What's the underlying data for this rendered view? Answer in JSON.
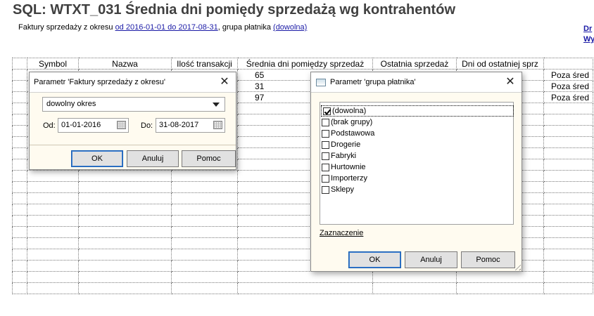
{
  "report": {
    "title": "SQL: WTXT_031 Średnia dni pomiędy sprzedażą wg kontrahentów",
    "subtitle_prefix": "Faktury sprzedaży z okresu ",
    "period_link": "od 2016-01-01 do 2017-08-31",
    "subtitle_mid": ", grupa płatnika ",
    "group_link": "(dowolna)",
    "right_link1": "Dr",
    "right_link2": "Wy",
    "columns": [
      "Symbol",
      "Nazwa",
      "Ilość transakcji",
      "Średnia dni pomiędzy sprzedaż",
      "Ostatnia sprzedaż",
      "Dni od ostatniej sprz",
      ""
    ],
    "rows": [
      [
        "",
        "",
        "",
        "65",
        "",
        "",
        "Poza śred"
      ],
      [
        "",
        "",
        "",
        "31",
        "",
        "",
        "Poza śred"
      ],
      [
        "",
        "",
        "",
        "97",
        "",
        "",
        "Poza śred"
      ]
    ]
  },
  "dialog_period": {
    "title": "Parametr 'Faktury sprzedaży z okresu'",
    "combo_value": "dowolny okres",
    "from_label": "Od:",
    "from_value": "01-01-2016",
    "to_label": "Do:",
    "to_value": "31-08-2017",
    "ok": "OK",
    "cancel": "Anuluj",
    "help": "Pomoc"
  },
  "dialog_group": {
    "title": "Parametr 'grupa płatnika'",
    "items": [
      {
        "label": "(dowolna)",
        "checked": true
      },
      {
        "label": "(brak grupy)",
        "checked": false
      },
      {
        "label": "Podstawowa",
        "checked": false
      },
      {
        "label": "Drogerie",
        "checked": false
      },
      {
        "label": "Fabryki",
        "checked": false
      },
      {
        "label": "Hurtownie",
        "checked": false
      },
      {
        "label": "Importerzy",
        "checked": false
      },
      {
        "label": "Sklepy",
        "checked": false
      }
    ],
    "selection_link": "Zaznaczenie",
    "ok": "OK",
    "cancel": "Anuluj",
    "help": "Pomoc"
  }
}
